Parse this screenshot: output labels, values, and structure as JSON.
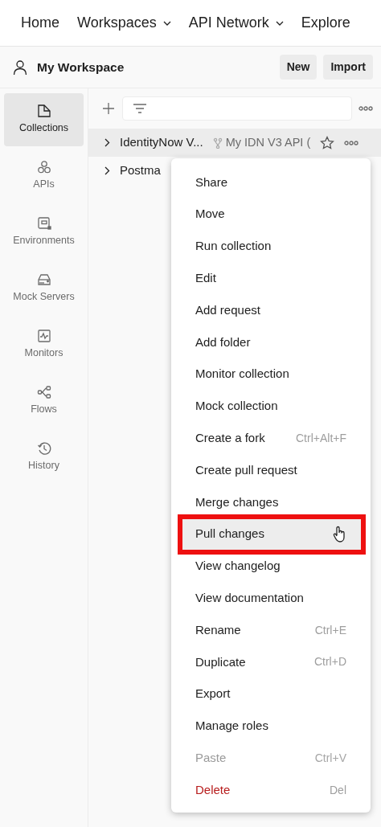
{
  "top_nav": [
    {
      "label": "Home",
      "dropdown": false
    },
    {
      "label": "Workspaces",
      "dropdown": true
    },
    {
      "label": "API Network",
      "dropdown": true
    },
    {
      "label": "Explore",
      "dropdown": false
    }
  ],
  "workspace": {
    "title": "My Workspace",
    "buttons": [
      "New",
      "Import"
    ]
  },
  "sidebar": {
    "items": [
      {
        "label": "Collections",
        "selected": true
      },
      {
        "label": "APIs",
        "selected": false
      },
      {
        "label": "Environments",
        "selected": false
      },
      {
        "label": "Mock Servers",
        "selected": false
      },
      {
        "label": "Monitors",
        "selected": false
      },
      {
        "label": "Flows",
        "selected": false
      },
      {
        "label": "History",
        "selected": false
      }
    ]
  },
  "collections": [
    {
      "name": "IdentityNow V...",
      "fork": "My IDN V3 API (",
      "starred": false,
      "selected": true
    },
    {
      "name": "Postma",
      "selected": false
    }
  ],
  "context_menu": {
    "items": [
      {
        "label": "Share",
        "kind": "normal",
        "hovered": false
      },
      {
        "label": "Move",
        "kind": "normal",
        "hovered": false
      },
      {
        "label": "Run collection",
        "kind": "normal",
        "hovered": false
      },
      {
        "label": "Edit",
        "kind": "normal",
        "hovered": false
      },
      {
        "label": "Add request",
        "kind": "normal",
        "hovered": false
      },
      {
        "label": "Add folder",
        "kind": "normal",
        "hovered": false
      },
      {
        "label": "Monitor collection",
        "kind": "normal",
        "hovered": false
      },
      {
        "label": "Mock collection",
        "kind": "normal",
        "hovered": false
      },
      {
        "label": "Create a fork",
        "shortcut": "Ctrl+Alt+F",
        "kind": "normal",
        "hovered": false
      },
      {
        "label": "Create pull request",
        "kind": "normal",
        "hovered": false
      },
      {
        "label": "Merge changes",
        "kind": "normal",
        "hovered": false
      },
      {
        "label": "Pull changes",
        "kind": "normal",
        "hovered": true,
        "highlighted": true
      },
      {
        "label": "View changelog",
        "kind": "normal",
        "hovered": false
      },
      {
        "label": "View documentation",
        "kind": "normal",
        "hovered": false
      },
      {
        "label": "Rename",
        "shortcut": "Ctrl+E",
        "kind": "normal",
        "hovered": false
      },
      {
        "label": "Duplicate",
        "shortcut": "Ctrl+D",
        "kind": "normal",
        "hovered": false
      },
      {
        "label": "Export",
        "kind": "normal",
        "hovered": false
      },
      {
        "label": "Manage roles",
        "kind": "normal",
        "hovered": false
      },
      {
        "label": "Paste",
        "shortcut": "Ctrl+V",
        "kind": "disabled",
        "hovered": false
      },
      {
        "label": "Delete",
        "shortcut": "Del",
        "kind": "danger",
        "hovered": false
      }
    ]
  }
}
